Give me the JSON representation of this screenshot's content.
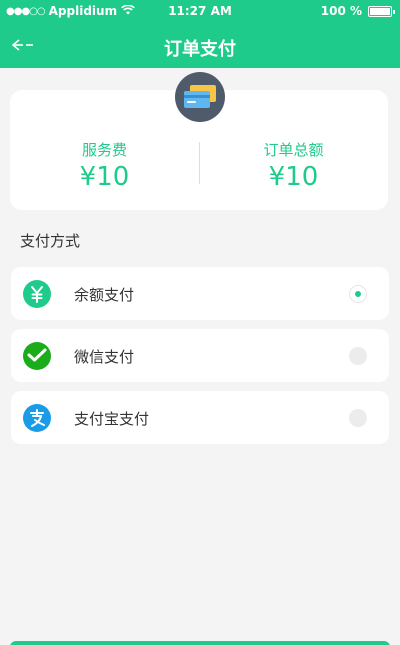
{
  "status_bar": {
    "carrier": "Applidium",
    "time": "11:27 AM",
    "battery": "100 %"
  },
  "nav": {
    "title": "订单支付"
  },
  "summary": {
    "service_fee_label": "服务费",
    "service_fee_value": "¥10",
    "order_total_label": "订单总额",
    "order_total_value": "¥10"
  },
  "payment": {
    "section_title": "支付方式",
    "methods": [
      {
        "label": "余额支付",
        "icon": "yuan-balance-icon",
        "selected": true
      },
      {
        "label": "微信支付",
        "icon": "wechat-icon",
        "selected": false
      },
      {
        "label": "支付宝支付",
        "icon": "alipay-icon",
        "selected": false
      }
    ]
  },
  "colors": {
    "accent": "#1fcb8b",
    "wechat": "#1aad19",
    "alipay": "#1a9be8"
  }
}
